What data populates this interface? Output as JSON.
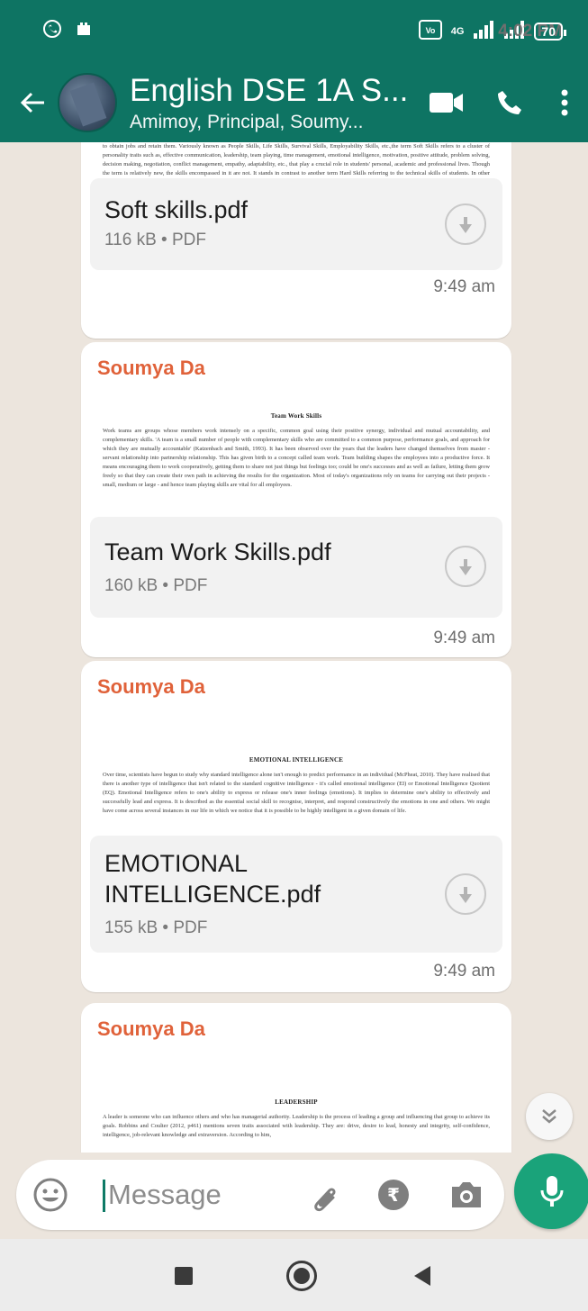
{
  "status_bar": {
    "time": "4:02 PM",
    "network": "4G",
    "battery": "70"
  },
  "header": {
    "title": "English DSE 1A S...",
    "subtitle": "Amimoy, Principal, Soumy...",
    "icons": [
      "back-arrow-icon",
      "video-call-icon",
      "phone-icon",
      "more-options-icon"
    ]
  },
  "messages": [
    {
      "sender": "",
      "preview_title": "",
      "preview_text": "to obtain jobs and retain them. Variously known as People Skills, Life Skills, Survival Skills, Employability Skills, etc.,the term Soft Skills refers to a cluster of personality traits such as, effective communication, leadership, team playing, time management, emotional intelligence, motivation, positive attitude, problem solving, decision making, negotiation, conflict management, empathy, adaptability, etc., that play a crucial role in students' personal, academic and professional lives. Though the term is relatively new, the skills encompassed in it are not. It stands in contrast to another term Hard Skills referring to the technical skills of students. In other words, hard skills include the subject knowledge and skills of the students of engineering.",
      "file_name": "Soft skills.pdf",
      "file_meta": "116 kB • PDF",
      "time": "9:49 am"
    },
    {
      "sender": "Soumya Da",
      "preview_title": "Team Work Skills",
      "preview_text": "Work teams are groups whose members work intensely on a specific, common goal using their positive synergy, individual and mutual accountability, and complementary skills. 'A team is a small number of people with complementary skills who are committed to a common purpose, performance goals, and approach for which they are mutually accountable' (Katzenbach and Smith, 1993). It has been observed over the years that the leaders have changed themselves from master - servant relationship into partnership relationship. This has given birth to a concept called team work. Team building shapes the employees into a productive force. It means encouraging them to work cooperatively, getting them to share not just things but feelings too; could be one's successes and as well as failure, letting them grow freely so that they can create their own path in achieving the results for the organization. Most of today's organizations rely on teams for carrying out their projects - small, medium or large - and hence team playing skills are vital for all employees.",
      "file_name": "Team Work Skills.pdf",
      "file_meta": "160 kB • PDF",
      "time": "9:49 am"
    },
    {
      "sender": "Soumya Da",
      "preview_title": "EMOTIONAL INTELLIGENCE",
      "preview_text": "Over time, scientists have begun to study why standard intelligence alone isn't enough to predict performance in an individual (McPheat, 2010). They have realised that there is another type of intelligence that isn't related to the standard cognitive intelligence - it's called emotional intelligence (EI) or Emotional Intelligence Quotient (EQ). Emotional Intelligence refers to one's ability to express or release one's inner feelings (emotions). It implies to determine one's ability to effectively and successfully lead and express. It is described as the essential social skill to recognise, interpret, and respond constructively the emotions in one and others. We might have come across several instances in our life in which we notice that it is possible to be highly intelligent in a given domain of life.",
      "file_name": "EMOTIONAL INTELLIGENCE.pdf",
      "file_meta": "155 kB • PDF",
      "time": "9:49 am"
    },
    {
      "sender": "Soumya Da",
      "preview_title": "LEADERSHIP",
      "preview_text": "A leader is someone who can influence others and who has managerial authority. Leadership is the process of leading a group and influencing that group to achieve its goals. Robbins and Coulter (2012, p461) mentions seven traits associated with leadership. They are: drive, desire to lead, honesty and integrity, self-confidence, intelligence, job-relevant knowledge and extraversion. According to him,",
      "file_name": "",
      "file_meta": "",
      "time": ""
    }
  ],
  "compose": {
    "placeholder": "Message"
  }
}
